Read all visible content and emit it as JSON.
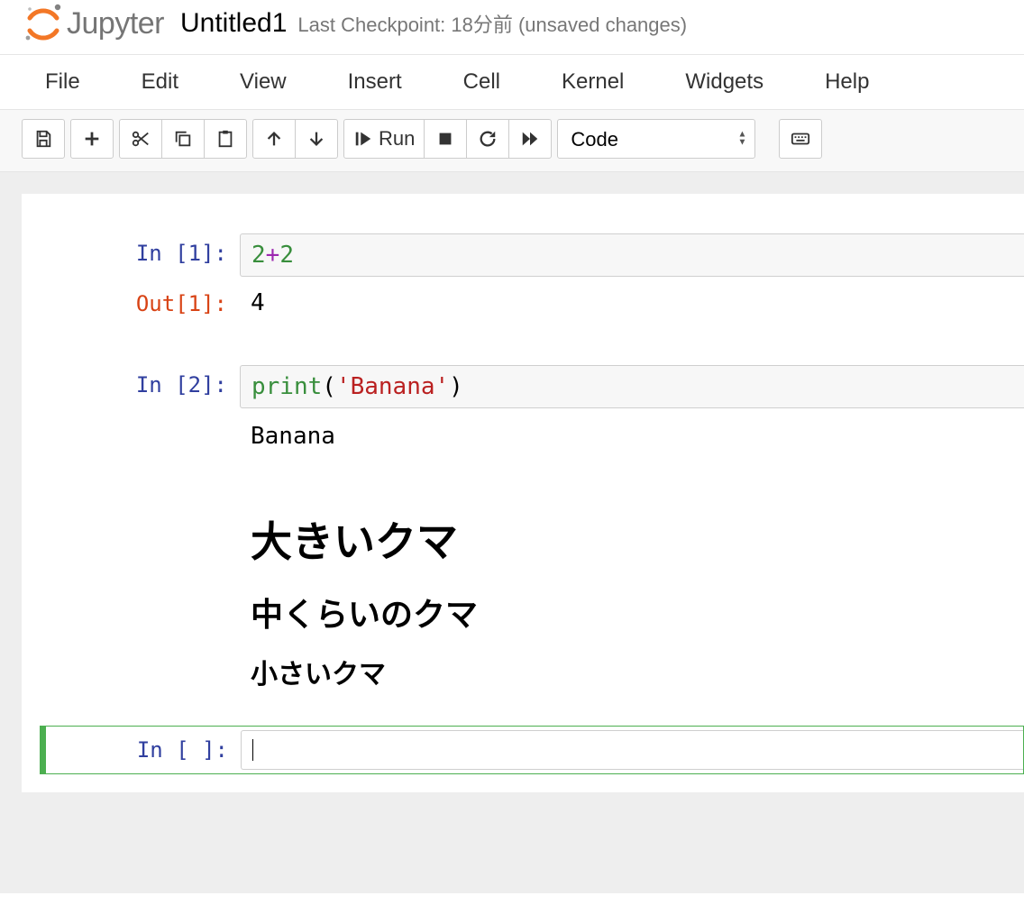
{
  "header": {
    "logo_text": "Jupyter",
    "title": "Untitled1",
    "checkpoint": "Last Checkpoint: 18分前   (unsaved changes)"
  },
  "menubar": {
    "items": [
      "File",
      "Edit",
      "View",
      "Insert",
      "Cell",
      "Kernel",
      "Widgets",
      "Help"
    ]
  },
  "toolbar": {
    "run_label": "Run",
    "celltype": "Code"
  },
  "cells": [
    {
      "type": "code",
      "prompt_in": "In [1]:",
      "source_tokens": [
        {
          "cls": "tok-num",
          "t": "2"
        },
        {
          "cls": "tok-op",
          "t": "+"
        },
        {
          "cls": "tok-num",
          "t": "2"
        }
      ],
      "prompt_out": "Out[1]:",
      "output": "4"
    },
    {
      "type": "code",
      "prompt_in": "In [2]:",
      "source_tokens": [
        {
          "cls": "tok-fn",
          "t": "print"
        },
        {
          "cls": "tok-punc",
          "t": "("
        },
        {
          "cls": "tok-str",
          "t": "'Banana'"
        },
        {
          "cls": "tok-punc",
          "t": ")"
        }
      ],
      "stream": "Banana"
    },
    {
      "type": "markdown",
      "h1": "大きいクマ",
      "h2": "中くらいのクマ",
      "h3": "小さいクマ"
    },
    {
      "type": "code",
      "selected": true,
      "prompt_in": "In [ ]:",
      "source_tokens": []
    }
  ]
}
